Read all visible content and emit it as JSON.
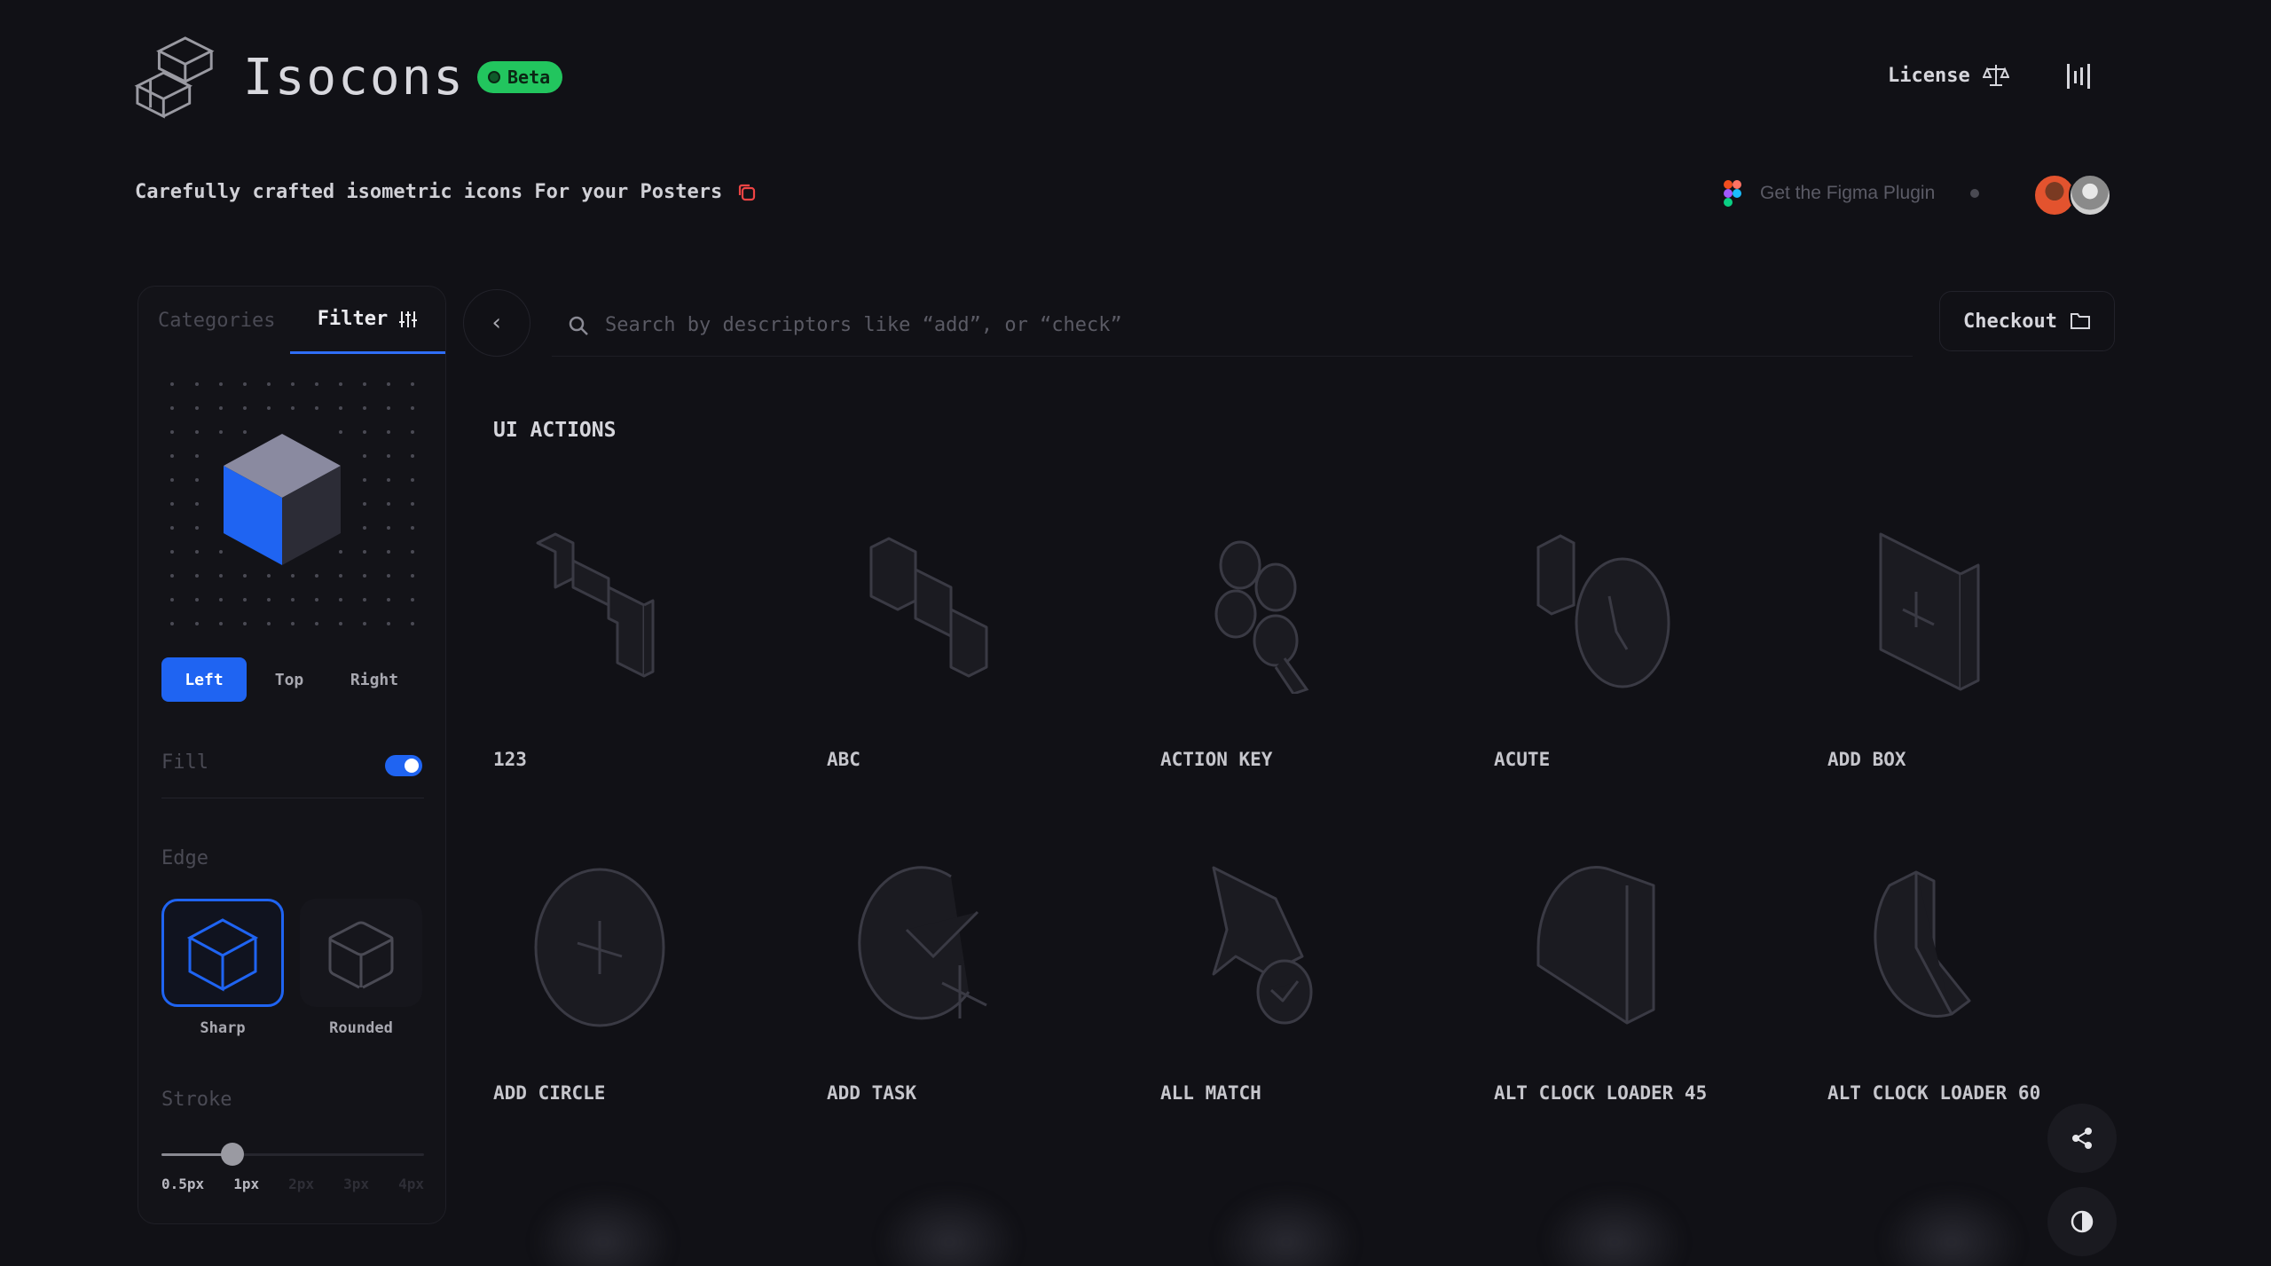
{
  "header": {
    "app_name": "Isocons",
    "badge": "Beta",
    "license_label": "License",
    "tagline": "Carefully crafted isometric icons For your Posters",
    "figma_label": "Get the Figma Plugin"
  },
  "sidebar": {
    "tabs": {
      "categories": "Categories",
      "filter": "Filter"
    },
    "directions": [
      "Left",
      "Top",
      "Right"
    ],
    "selected_direction": "Left",
    "fill_label": "Fill",
    "fill_on": true,
    "edge_label": "Edge",
    "edge_options": [
      "Sharp",
      "Rounded"
    ],
    "selected_edge": "Sharp",
    "stroke_label": "Stroke",
    "stroke_options": [
      "0.5px",
      "1px",
      "2px",
      "3px",
      "4px"
    ],
    "selected_stroke": "1px"
  },
  "search": {
    "placeholder": "Search by descriptors like “add”, or “check”"
  },
  "checkout_label": "Checkout",
  "section": {
    "title": "UI ACTIONS",
    "icons": [
      "123",
      "ABC",
      "ACTION KEY",
      "ACUTE",
      "ADD BOX",
      "ADD CIRCLE",
      "ADD TASK",
      "ALL MATCH",
      "ALT CLOCK LOADER 45",
      "ALT CLOCK LOADER 60"
    ]
  },
  "colors": {
    "background": "#111116",
    "accent": "#1f64f2",
    "beta_green": "#22c55e"
  },
  "icon_names": {
    "share": "share-icon",
    "theme": "contrast-icon",
    "license": "scales-icon",
    "checkout": "folder-icon"
  }
}
